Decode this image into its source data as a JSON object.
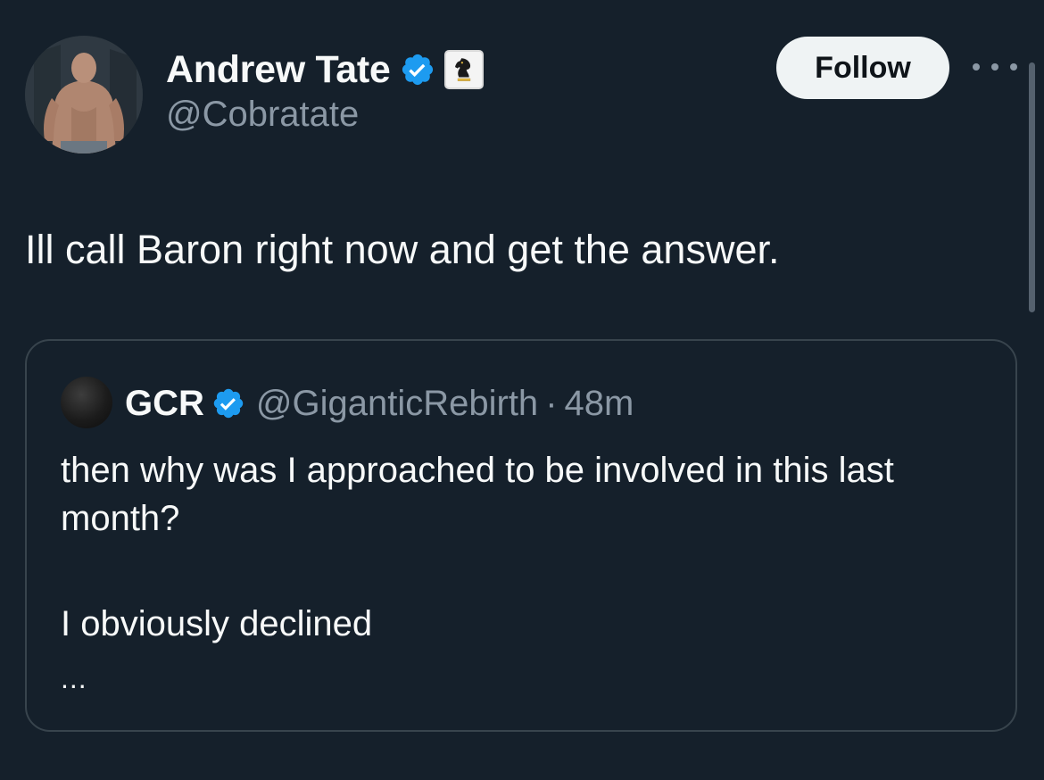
{
  "author": {
    "display_name": "Andrew Tate",
    "handle": "@Cobratate",
    "avatar_icon": "profile-photo",
    "verified_icon": "verified-badge-icon",
    "affiliate_icon": "chess-knight-icon"
  },
  "actions": {
    "follow_label": "Follow",
    "more_icon": "more-options-icon"
  },
  "tweet": {
    "text": "Ill call Baron right now and get the answer."
  },
  "quote": {
    "display_name": "GCR",
    "handle": "@GiganticRebirth",
    "separator": "·",
    "time": "48m",
    "lines": [
      "then why was I approached to be involved in this last month?",
      "I obviously declined"
    ],
    "truncation": "..."
  },
  "colors": {
    "background": "#15202b",
    "text_primary": "#f7f9f9",
    "text_secondary": "#8b98a5",
    "verified_blue": "#1d9bf0",
    "border": "#38444d",
    "follow_bg": "#eff3f4"
  }
}
